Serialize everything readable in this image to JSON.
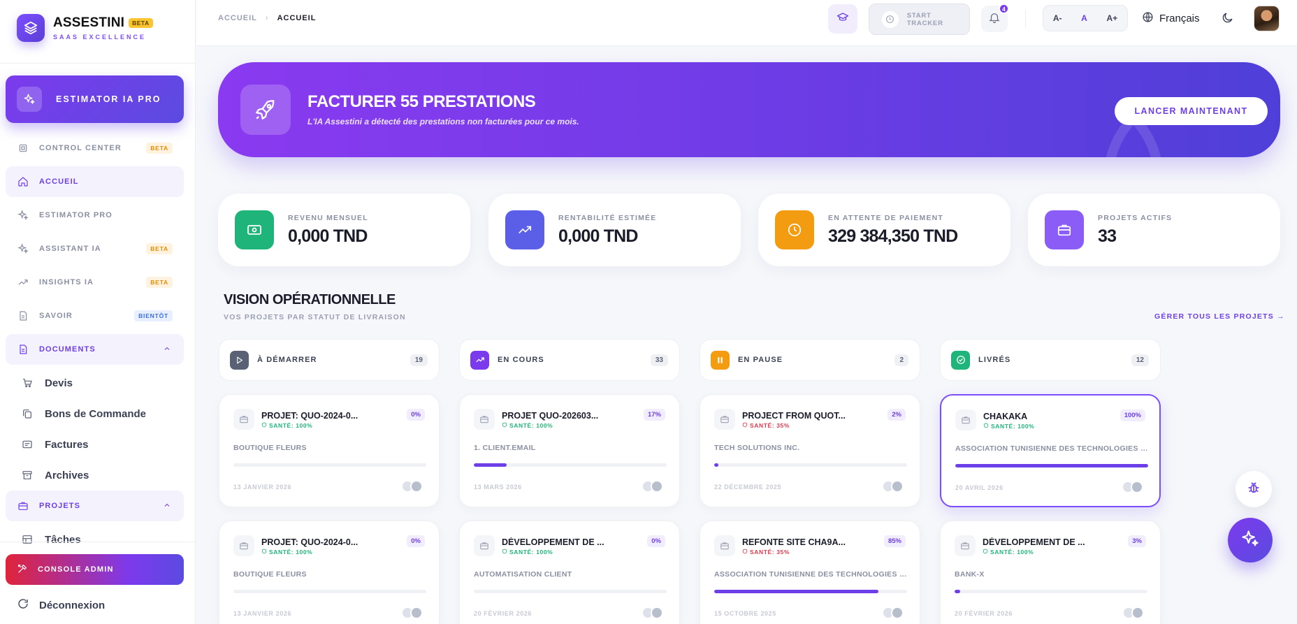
{
  "brand": {
    "name": "ASSESTINI",
    "badge": "BETA",
    "tagline": "SAAS EXCELLENCE"
  },
  "sidebar": {
    "estimator_cta": "ESTIMATOR IA PRO",
    "items": [
      {
        "label": "CONTROL CENTER",
        "tag": "BETA",
        "icon": "chip-icon"
      },
      {
        "label": "ACCUEIL",
        "icon": "home-icon"
      },
      {
        "label": "ESTIMATOR PRO",
        "icon": "sparkle-icon"
      },
      {
        "label": "ASSISTANT IA",
        "tag": "BETA",
        "icon": "sparkle-icon"
      },
      {
        "label": "INSIGHTS IA",
        "tag": "BETA",
        "icon": "trend-icon"
      },
      {
        "label": "SAVOIR",
        "tag": "BIENTÔT",
        "icon": "book-icon"
      },
      {
        "label": "DOCUMENTS",
        "icon": "document-icon"
      },
      {
        "label": "PROJETS",
        "icon": "briefcase-icon"
      }
    ],
    "documents_sub": [
      "Devis",
      "Bons de Commande",
      "Factures",
      "Archives"
    ],
    "projets_sub": [
      "Tâches"
    ],
    "admin": "CONSOLE ADMIN",
    "logout": "Déconnexion"
  },
  "topbar": {
    "breadcrumb": [
      "ACCUEIL",
      "ACCUEIL"
    ],
    "tracker": "START TRACKER",
    "notifications": "4",
    "font_sizes": [
      "A-",
      "A",
      "A+"
    ],
    "language": "Français"
  },
  "hero": {
    "title": "FACTURER 55 PRESTATIONS",
    "subtitle": "L'IA Assestini a détecté des prestations non facturées pour ce mois.",
    "cta": "LANCER MAINTENANT"
  },
  "stats": [
    {
      "label": "REVENU MENSUEL",
      "value": "0,000 TND",
      "color": "#1fb57a"
    },
    {
      "label": "RENTABILITÉ ESTIMÉE",
      "value": "0,000 TND",
      "color": "#5b5fe8"
    },
    {
      "label": "EN ATTENTE DE PAIEMENT",
      "value": "329 384,350 TND",
      "color": "#f39c12"
    },
    {
      "label": "PROJETS ACTIFS",
      "value": "33",
      "color": "#8b5cf6"
    }
  ],
  "section": {
    "title": "VISION OPÉRATIONNELLE",
    "subtitle": "VOS PROJETS PAR STATUT DE LIVRAISON",
    "link": "GÉRER TOUS LES PROJETS →"
  },
  "columns": [
    {
      "label": "À DÉMARRER",
      "count": "19",
      "color": "#5b6175"
    },
    {
      "label": "EN COURS",
      "count": "33",
      "color": "#7c3aed"
    },
    {
      "label": "EN PAUSE",
      "count": "2",
      "color": "#f39c12"
    },
    {
      "label": "LIVRÉS",
      "count": "12",
      "color": "#1fb57a"
    }
  ],
  "projects": [
    [
      {
        "title": "PROJET: QUO-2024-0...",
        "health": "SANTÉ: 100%",
        "health_state": "good",
        "progress_label": "0%",
        "progress": 0,
        "client": "BOUTIQUE FLEURS",
        "date": "13 JANVIER 2026"
      },
      {
        "title": "PROJET: QUO-2024-0...",
        "health": "SANTÉ: 100%",
        "health_state": "good",
        "progress_label": "0%",
        "progress": 0,
        "client": "BOUTIQUE FLEURS",
        "date": "13 JANVIER 2026"
      }
    ],
    [
      {
        "title": "PROJET QUO-202603...",
        "health": "SANTÉ: 100%",
        "health_state": "good",
        "progress_label": "17%",
        "progress": 17,
        "client": "1. CLIENT.EMAIL",
        "date": "13 MARS 2026"
      },
      {
        "title": "DÉVELOPPEMENT DE ...",
        "health": "SANTÉ: 100%",
        "health_state": "good",
        "progress_label": "0%",
        "progress": 0,
        "client": "AUTOMATISATION CLIENT",
        "date": "20 FÉVRIER 2026"
      }
    ],
    [
      {
        "title": "PROJECT FROM QUOT...",
        "health": "SANTÉ: 35%",
        "health_state": "bad",
        "progress_label": "2%",
        "progress": 2,
        "client": "TECH SOLUTIONS INC.",
        "date": "22 DÉCEMBRE 2025"
      },
      {
        "title": "REFONTE SITE CHA9A...",
        "health": "SANTÉ: 35%",
        "health_state": "bad",
        "progress_label": "85%",
        "progress": 85,
        "client": "ASSOCIATION TUNISIENNE DES TECHNOLOGIES DIGITALES",
        "date": "15 OCTOBRE 2025"
      }
    ],
    [
      {
        "title": "CHAKAKA",
        "health": "SANTÉ: 100%",
        "health_state": "good",
        "progress_label": "100%",
        "progress": 100,
        "client": "ASSOCIATION TUNISIENNE DES TECHNOLOGIES DIGITALES",
        "date": "20 AVRIL 2026",
        "selected": true
      },
      {
        "title": "DÉVELOPPEMENT DE ...",
        "health": "SANTÉ: 100%",
        "health_state": "good",
        "progress_label": "3%",
        "progress": 3,
        "client": "BANK-X",
        "date": "20 FÉVRIER 2026"
      }
    ]
  ]
}
